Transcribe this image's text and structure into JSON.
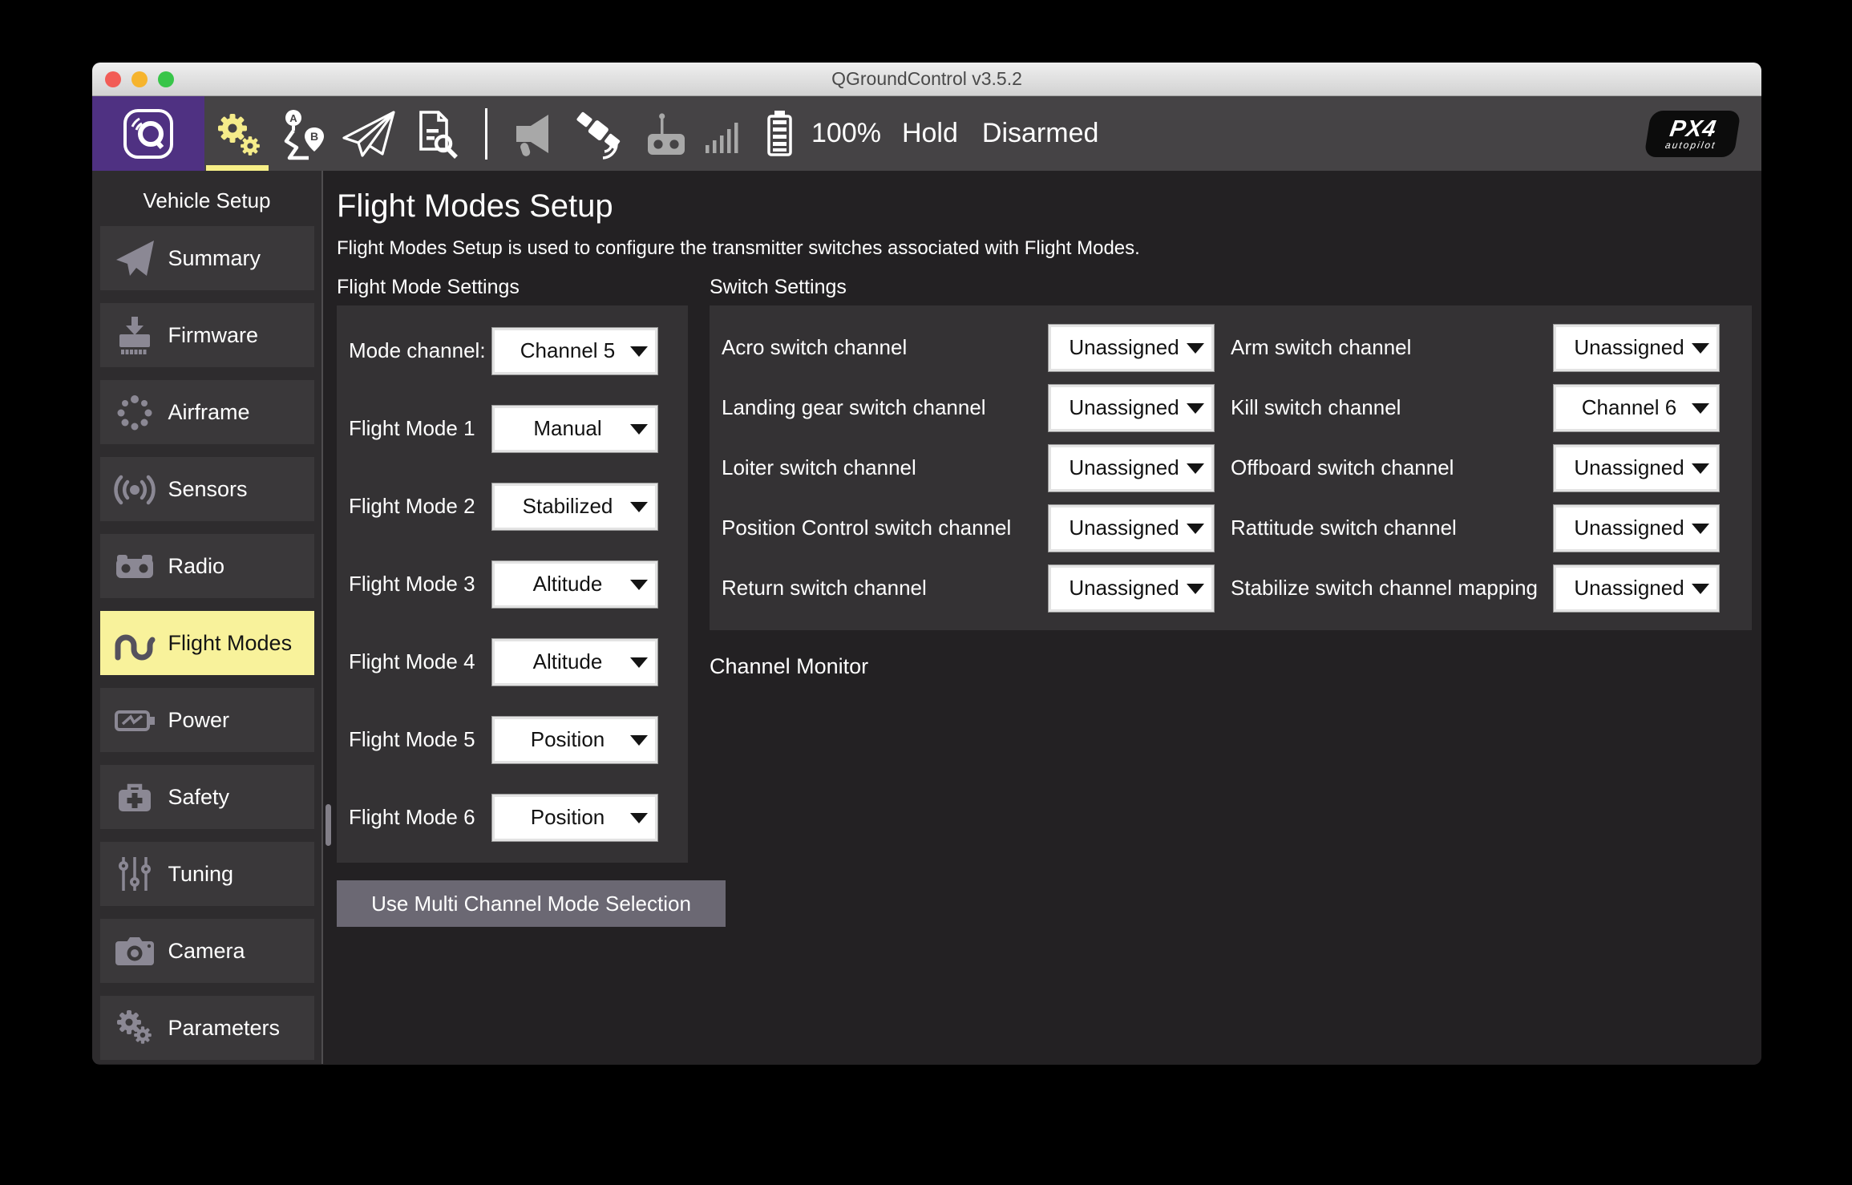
{
  "window": {
    "title": "QGroundControl v3.5.2"
  },
  "colors": {
    "accent_yellow": "#f7ef87",
    "brand_purple": "#4f3182",
    "selected_item_yellow": "#f8f29b",
    "button_gray_purple": "#6b6873"
  },
  "toolbar": {
    "battery_pct": "100%",
    "flight_mode": "Hold",
    "armed_state": "Disarmed",
    "px4_logo_line1": "PX4",
    "px4_logo_line2": "autopilot"
  },
  "sidebar": {
    "header": "Vehicle Setup",
    "items": [
      {
        "label": "Summary",
        "icon": "paper-plane-icon",
        "selected": false
      },
      {
        "label": "Firmware",
        "icon": "firmware-chip-icon",
        "selected": false
      },
      {
        "label": "Airframe",
        "icon": "dotted-ring-icon",
        "selected": false
      },
      {
        "label": "Sensors",
        "icon": "signal-waves-icon",
        "selected": false
      },
      {
        "label": "Radio",
        "icon": "rc-transmitter-icon",
        "selected": false
      },
      {
        "label": "Flight Modes",
        "icon": "squiggle-wave-icon",
        "selected": true
      },
      {
        "label": "Power",
        "icon": "battery-bolt-icon",
        "selected": false
      },
      {
        "label": "Safety",
        "icon": "first-aid-kit-icon",
        "selected": false
      },
      {
        "label": "Tuning",
        "icon": "sliders-icon",
        "selected": false
      },
      {
        "label": "Camera",
        "icon": "camera-icon",
        "selected": false
      },
      {
        "label": "Parameters",
        "icon": "gears-icon",
        "selected": false
      }
    ]
  },
  "main": {
    "title": "Flight Modes Setup",
    "description": "Flight Modes Setup is used to configure the transmitter switches associated with Flight Modes.",
    "flight_mode_settings": {
      "heading": "Flight Mode Settings",
      "rows": [
        {
          "label": "Mode channel:",
          "value": "Channel 5"
        },
        {
          "label": "Flight Mode 1",
          "value": "Manual"
        },
        {
          "label": "Flight Mode 2",
          "value": "Stabilized"
        },
        {
          "label": "Flight Mode 3",
          "value": "Altitude"
        },
        {
          "label": "Flight Mode 4",
          "value": "Altitude"
        },
        {
          "label": "Flight Mode 5",
          "value": "Position"
        },
        {
          "label": "Flight Mode 6",
          "value": "Position"
        }
      ],
      "button": "Use Multi Channel Mode Selection"
    },
    "switch_settings": {
      "heading": "Switch Settings",
      "rows": [
        {
          "left_label": "Acro switch channel",
          "left_value": "Unassigned",
          "right_label": "Arm switch channel",
          "right_value": "Unassigned"
        },
        {
          "left_label": "Landing gear switch channel",
          "left_value": "Unassigned",
          "right_label": "Kill switch channel",
          "right_value": "Channel 6"
        },
        {
          "left_label": "Loiter switch channel",
          "left_value": "Unassigned",
          "right_label": "Offboard switch channel",
          "right_value": "Unassigned"
        },
        {
          "left_label": "Position Control switch channel",
          "left_value": "Unassigned",
          "right_label": "Rattitude switch channel",
          "right_value": "Unassigned"
        },
        {
          "left_label": "Return switch channel",
          "left_value": "Unassigned",
          "right_label": "Stabilize switch channel mapping",
          "right_value": "Unassigned"
        }
      ]
    },
    "channel_monitor": "Channel Monitor"
  }
}
